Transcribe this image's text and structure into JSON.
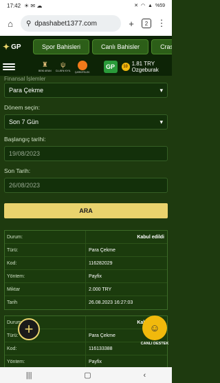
{
  "status": {
    "time": "17:42",
    "battery": "%59"
  },
  "browser": {
    "url": "dpashabet1377.com",
    "tab_count": "2"
  },
  "site_nav": {
    "logo": "GP",
    "items": [
      "Spor Bahisleri",
      "Canlı Bahisler",
      "Crash"
    ]
  },
  "header": {
    "partners": [
      "BENİ ARAN",
      "CLUB'N KIYIL",
      "ÇARKIFELEK"
    ],
    "gift_label": "GP",
    "balance": "1.81 TRY",
    "username": "Ozgeburak",
    "coin_badge": "10"
  },
  "form": {
    "faded_label": "Finansal İşlemler",
    "transaction_type": "Para Çekme",
    "period_label": "Dönem seçin:",
    "period_value": "Son 7 Gün",
    "start_label": "Başlangıç tarihi:",
    "start_value": "19/08/2023",
    "end_label": "Son Tarih:",
    "end_value": "26/08/2023",
    "search_label": "ARA"
  },
  "records": [
    {
      "status_label": "Durum:",
      "status_value": "Kabul edildi",
      "type_label": "Türü:",
      "type_value": "Para Çekme",
      "code_label": "Kod:",
      "code_value": "116282029",
      "method_label": "Yöntem:",
      "method_value": "Payfix",
      "amount_label": "Miktar",
      "amount_value": "2.000 TRY",
      "date_label": "Tarih",
      "date_value": "26.08.2023 16:27:03"
    },
    {
      "status_label": "Durum:",
      "status_value": "Kabul edildi",
      "type_label": "Türü:",
      "type_value": "Para Çekme",
      "code_label": "Kod:",
      "code_value": "116133388",
      "method_label": "Yöntem:",
      "method_value": "Payfix"
    }
  ],
  "support": {
    "label": "CANLI DESTEK"
  }
}
